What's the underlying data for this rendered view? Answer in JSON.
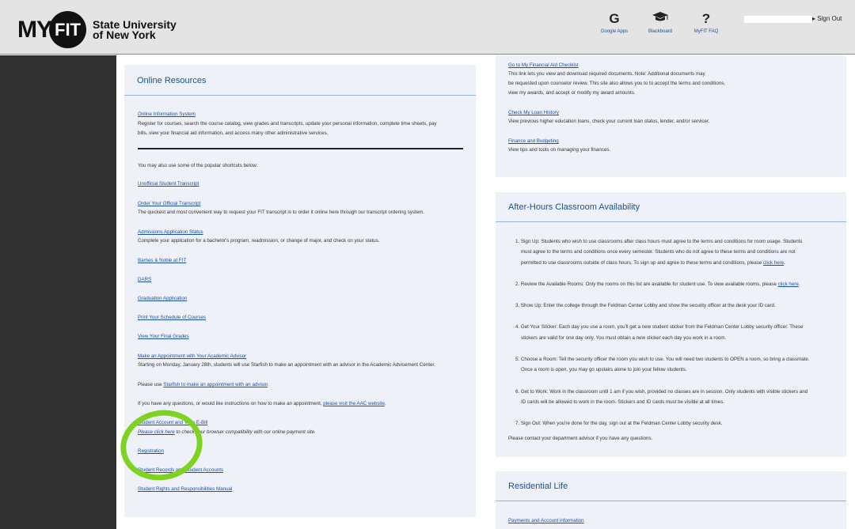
{
  "header": {
    "logo_my": "MY",
    "logo_fit": "FIT",
    "logo_line1": "State University",
    "logo_line2": "of New York",
    "links": [
      {
        "icon": "G",
        "label": "Google Apps"
      },
      {
        "icon": "🎓",
        "label": "Blackboard"
      },
      {
        "icon": "?",
        "label": "MyFIT FAQ"
      }
    ],
    "signout": "Sign Out"
  },
  "online_resources": {
    "title": "Online Resources",
    "ois_link": "Online Information System",
    "ois_desc1": "Register for courses, search the course catalog, view grades and transcripts, update your personal information, complete time sheets, pay",
    "ois_desc2": "bills, view your financial aid information, and access many other administrative services.",
    "shortcuts_intro": "You may also use some of the popular shortcuts below:",
    "unofficial_transcript": "Unofficial Student Transcript",
    "order_transcript": "Order Your Official Transcript",
    "order_transcript_desc": "The quickest and most convenient way to request your FIT transcript is to order it online here through our transcript ordering system.",
    "admissions_status": "Admissions Application Status",
    "admissions_desc": "Complete your application for a bachelor's program, readmission, or change of major, and check on your status.",
    "barnes": "Barnes & Noble at FIT",
    "dars": "DARS",
    "graduation": "Graduation Application",
    "print_schedule": "Print Your Schedule of Courses",
    "final_grades": "View Your Final Grades",
    "advisor_link": "Make an Appointment with Your Academic Advisor",
    "advisor_desc": "Starting on Monday, January 28th, students will use Starfish to make an appointment with an advisor in the Academic Advisement Center.",
    "please_use": "Please use ",
    "starfish_link": "Starfish to make an appointment with an advisor",
    "please_use_end": ".",
    "questions_text": "If you have any questions, or would like instructions on how to make an appointment, ",
    "aac_link": "please visit the AAC website",
    "questions_end": ".",
    "ebill_link": "Student Account and View E-Bill",
    "please_click_here": "Please click here",
    "ebill_desc": " to check your browser compatibility with our online payment site.",
    "registration": "Registration",
    "records": "Student Records and Student Accounts",
    "rights": "Student Rights and Responsibilities Manual"
  },
  "financial": {
    "checklist_link": "Go to My Financial Aid Checklist",
    "checklist_desc1": "This link lets you view and download required documents. Note: Additional documents may",
    "checklist_desc2": "be requested upon counselor review. This site also allows you to to accept the terms and conditions,",
    "checklist_desc3": "view my awards, and accept or modify my award amounts.",
    "loan_link": "Check My Loan History",
    "loan_desc": "View previous higher education loans, check your current loan status, lender, and/or servicer.",
    "budget_link": "Finance and Budgeting",
    "budget_desc": "View tips and tools on managing your finances."
  },
  "after_hours": {
    "title": "After-Hours Classroom Availability",
    "item1_a": "1. Sign Up: Students who wish to use classrooms after class hours must agree to the terms and conditions for room usage. Students",
    "item1_b": "must agree to the terms and conditions once every semester. Students who do not agree to these terms and conditions are not",
    "item1_c": "permitted to use classrooms outside of class hours. To sign up and agree to these terms and conditions, please ",
    "click_here": "click here",
    "item1_end": ".",
    "item2": "2. Review the Available Rooms: Only the rooms on this list are available for student use. To view available rooms, please ",
    "item2_end": ".",
    "item3": "3. Show Up: Enter the college through the Feldman Center Lobby and show the security officer at the desk your ID card.",
    "item4_a": "4. Get Your Sticker: Each day you use a room, you'll get a new student sticker from the Feldman Center Lobby security officer. These",
    "item4_b": "stickers are valid for one day only. You must obtain a new sticker each day you work in a room.",
    "item5_a": "5. Choose a Room: Tell the security officer the room you wish to use. You will need two students to OPEN a room, so bring a classmate.",
    "item5_b": "Once a room is open, you may go upstairs alone to join your fellow students.",
    "item6_a": "6. Get to Work: Work in the classroom until 1 am if you wish, provided no classes are in session. Only students with visible stickers and",
    "item6_b": "ID cards will be allowed to work in the room. Stickers and ID cards must be visible at all times.",
    "item7": "7. Sign Out: When you're done for the day, sign out at the Feldman Center Lobby security desk.",
    "contact": "Please contact your department advisor if you have any questions."
  },
  "residential": {
    "title": "Residential Life",
    "payments_link": "Payments and Account information"
  },
  "colors": {
    "header_bg": "#e4e4e4",
    "sidebar_bg": "#313131",
    "panel_bg": "#eef2f8",
    "title_blue": "#1e4f86",
    "link_blue": "#1a4fa0",
    "annotation_green": "#7ed321"
  }
}
